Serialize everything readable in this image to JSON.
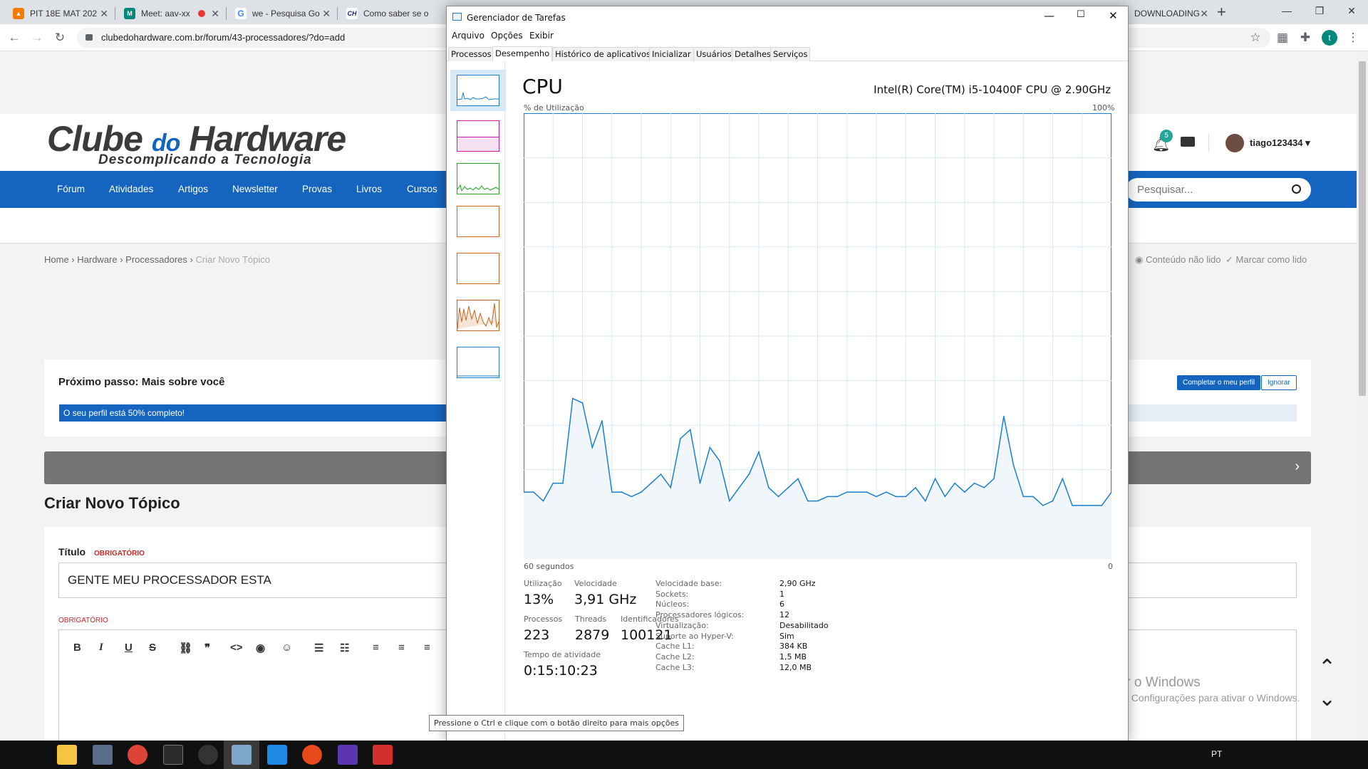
{
  "browser": {
    "tabs": [
      {
        "title": "PIT 18E MAT 202",
        "fav_color": "#f57c00",
        "fav": "▲"
      },
      {
        "title": "Meet: aav-xx",
        "fav_color": "#00897b",
        "fav": "M"
      },
      {
        "title": "we - Pesquisa Go",
        "fav_color": "#ffffff",
        "fav": "G"
      },
      {
        "title": "Como saber se o",
        "fav_color": "#ffffff",
        "fav": "CH"
      },
      {
        "title": "DOWNLOADING",
        "fav_color": "#ffffff",
        "fav": ""
      }
    ],
    "url": "clubedohardware.com.br/forum/43-processadores/?do=add",
    "avatar_letter": "t"
  },
  "site": {
    "logo_main": "Clube",
    "logo_do": "do",
    "logo_brand": "Hardware",
    "tagline": "Descomplicando a Tecnologia",
    "notif_count": "5",
    "username": "tiago123434",
    "nav": [
      "Fórum",
      "Atividades",
      "Artigos",
      "Newsletter",
      "Provas",
      "Livros",
      "Cursos"
    ],
    "search_placeholder": "Pesquisar...",
    "breadcrumb": [
      "Home",
      "Hardware",
      "Processadores",
      "Criar Novo Tópico"
    ],
    "unread_link": "Conteúdo não lido",
    "mark_read_link": "Marcar como lido",
    "next_step": "Próximo passo: Mais sobre você",
    "complete_profile_btn": "Completar o meu perfil",
    "ignore_btn": "Ignorar",
    "profile_progress_text": "O seu perfil está 50% completo!",
    "profile_progress": 0.5,
    "page_title": "Criar Novo Tópico",
    "title_label": "Título",
    "required": "OBRIGATÓRIO",
    "title_value": "GENTE MEU PROCESSADOR ESTA",
    "watermark_title": "Ativar o Windows",
    "watermark_sub": "Acesse Configurações para ativar o Windows."
  },
  "taskmgr": {
    "window_title": "Gerenciador de Tarefas",
    "menu": [
      "Arquivo",
      "Opções",
      "Exibir"
    ],
    "tabs": [
      "Processos",
      "Desempenho",
      "Histórico de aplicativos",
      "Inicializar",
      "Usuários",
      "Detalhes",
      "Serviços"
    ],
    "active_tab": "Desempenho",
    "heading": "CPU",
    "cpu_name": "Intel(R) Core(TM) i5-10400F CPU @ 2.90GHz",
    "y_label": "% de Utilização",
    "y_max_label": "100%",
    "x_label": "60 segundos",
    "x_min_label": "0",
    "stats": {
      "util_label": "Utilização",
      "util": "13%",
      "speed_label": "Velocidade",
      "speed": "3,91 GHz",
      "proc_label": "Processos",
      "proc": "223",
      "threads_label": "Threads",
      "threads": "2879",
      "handles_label": "Identificadores",
      "handles": "100121",
      "uptime_label": "Tempo de atividade",
      "uptime": "0:15:10:23"
    },
    "details": [
      {
        "k": "Velocidade base:",
        "v": "2,90 GHz"
      },
      {
        "k": "Sockets:",
        "v": "1"
      },
      {
        "k": "Núcleos:",
        "v": "6"
      },
      {
        "k": "Processadores lógicos:",
        "v": "12"
      },
      {
        "k": "Virtualização:",
        "v": "Desabilitado"
      },
      {
        "k": "Suporte ao Hyper-V:",
        "v": "Sim"
      },
      {
        "k": "Cache L1:",
        "v": "384 KB"
      },
      {
        "k": "Cache L2:",
        "v": "1,5 MB"
      },
      {
        "k": "Cache L3:",
        "v": "12,0 MB"
      }
    ],
    "tooltip": "Pressione o Ctrl e clique com o botão direito para mais opções",
    "thumb_colors": [
      "#1a7fd0",
      "#c81ea8",
      "#2aa52a",
      "#d2691e",
      "#d2691e",
      "#c8641e",
      "#1a7fd0"
    ]
  },
  "chart_data": {
    "type": "area",
    "x": [
      60,
      59,
      58,
      57,
      56,
      55,
      54,
      53,
      52,
      51,
      50,
      49,
      48,
      47,
      46,
      45,
      44,
      43,
      42,
      41,
      40,
      39,
      38,
      37,
      36,
      35,
      34,
      33,
      32,
      31,
      30,
      29,
      28,
      27,
      26,
      25,
      24,
      23,
      22,
      21,
      20,
      19,
      18,
      17,
      16,
      15,
      14,
      13,
      12,
      11,
      10,
      9,
      8,
      7,
      6,
      5,
      4,
      3,
      2,
      1,
      0
    ],
    "values": [
      15,
      15,
      13,
      17,
      17,
      36,
      35,
      25,
      31,
      15,
      15,
      14,
      15,
      17,
      19,
      16,
      27,
      29,
      17,
      25,
      22,
      13,
      16,
      19,
      24,
      16,
      14,
      16,
      18,
      13,
      13,
      14,
      14,
      15,
      15,
      15,
      14,
      15,
      14,
      14,
      16,
      13,
      18,
      14,
      17,
      15,
      17,
      16,
      18,
      32,
      21,
      14,
      14,
      12,
      13,
      18,
      12,
      12,
      12,
      12,
      15
    ],
    "title": "CPU",
    "xlabel": "60 segundos",
    "ylabel": "% de Utilização",
    "ylim": [
      0,
      100
    ],
    "color": "#1a7fd0"
  }
}
